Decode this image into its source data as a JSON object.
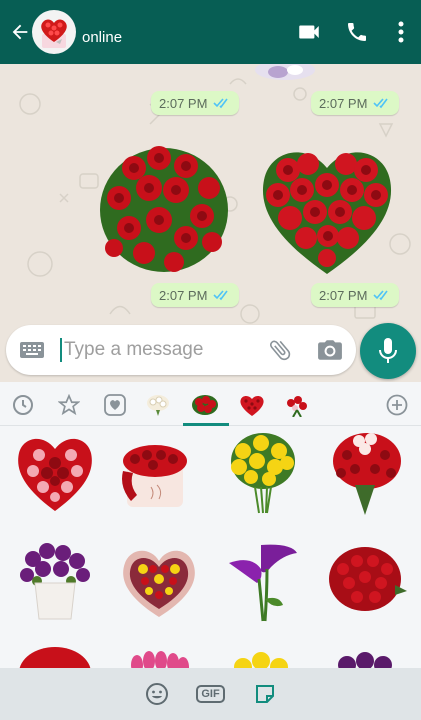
{
  "header": {
    "status": "online",
    "contact_icon": "heart-rose-box-icon",
    "back_icon": "arrow-left-icon",
    "video_icon": "video-call-icon",
    "phone_icon": "phone-icon",
    "menu_icon": "more-vert-icon",
    "color": "#075e54"
  },
  "chat": {
    "messages": [
      {
        "time": "2:07 PM",
        "status_icon": "double-check-icon"
      },
      {
        "time": "2:07 PM",
        "status_icon": "double-check-icon"
      },
      {
        "time": "2:07 PM",
        "status_icon": "double-check-icon"
      },
      {
        "time": "2:07 PM",
        "status_icon": "double-check-icon"
      }
    ],
    "stickers": [
      "rose-bouquet-sticker",
      "rose-heart-sticker"
    ],
    "bubble_color": "#dcf8c6",
    "tick_color": "#4fc3f7"
  },
  "composer": {
    "placeholder": "Type a message",
    "keyboard_icon": "keyboard-icon",
    "attach_icon": "paperclip-icon",
    "camera_icon": "camera-icon",
    "mic_icon": "mic-icon",
    "accent": "#128c7e"
  },
  "sticker_panel": {
    "tabs": [
      "recent-icon",
      "star-icon",
      "heart-icon",
      "white-roses-pack",
      "red-roses-pack",
      "rose-heart-pack",
      "rose-mix-pack",
      "add-icon"
    ],
    "active_tab": 4,
    "stickers": [
      "rose-heart-sticker",
      "rose-box-sticker",
      "yellow-rose-bouquet-sticker",
      "red-white-rose-bouquet-sticker",
      "purple-flowers-vase-sticker",
      "heart-flower-box-sticker",
      "purple-calla-lily-sticker",
      "red-rose-bunch-sticker",
      "red-flowers-sticker",
      "pink-tulips-sticker",
      "yellow-roses-sticker",
      "purple-roses-sticker"
    ],
    "bottom_tabs": {
      "emoji_icon": "emoji-icon",
      "gif_label": "GIF",
      "sticker_icon": "sticker-icon"
    }
  }
}
